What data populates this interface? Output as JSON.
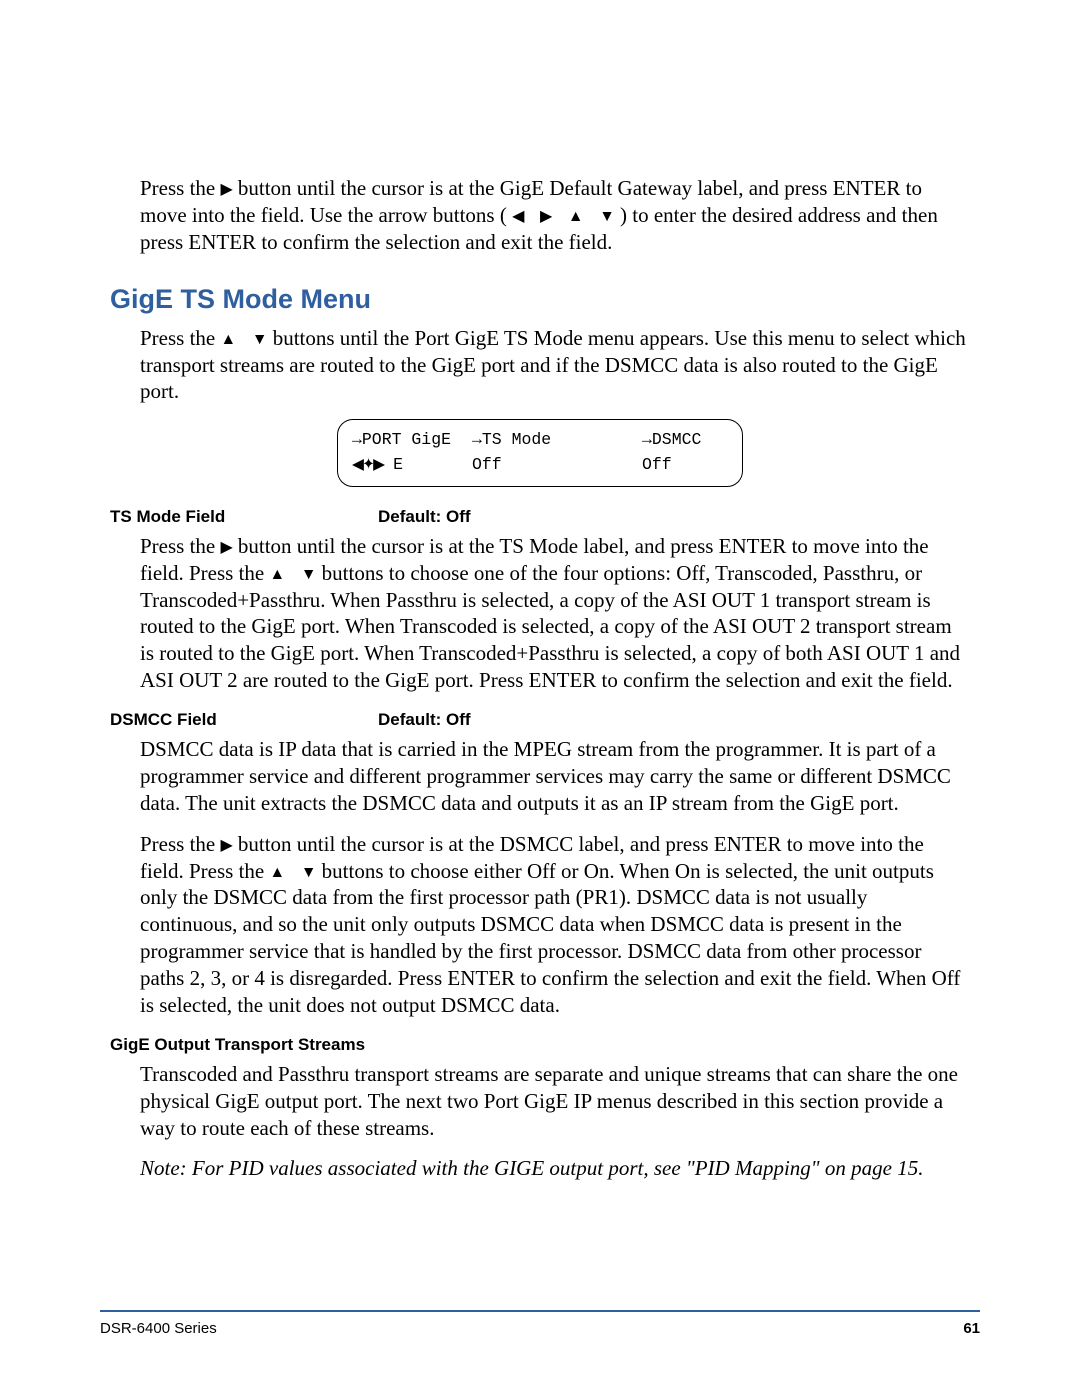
{
  "intro": {
    "p1a": "Press the ",
    "p1b": " button until the cursor is at the GigE Default Gateway label, and press ENTER to move into the field. Use the arrow buttons (",
    "p1c": ") to enter the desired address and then press ENTER to confirm the selection and exit the field."
  },
  "section": {
    "title": "GigE TS Mode Menu",
    "p1a": "Press the ",
    "p1b": " buttons until the Port GigE TS Mode menu appears. Use this menu to select which transport streams are routed to the GigE port and if the DSMCC data is also routed to the GigE port."
  },
  "lcd": {
    "r1c1": "→PORT GigE",
    "r1c2": "→TS Mode",
    "r1c3": "→DSMCC",
    "r2c1_suffix": " E",
    "r2c2": "Off",
    "r2c3": "Off"
  },
  "tsmode": {
    "label": "TS Mode Field",
    "default": "Default: Off",
    "p1a": "Press the ",
    "p1b": " button until the cursor is at the TS Mode label, and press ENTER to move into the field. Press the ",
    "p1c": " buttons to choose one of the four options: Off, Transcoded, Passthru, or Transcoded+Passthru. When Passthru is selected, a copy of the ASI OUT 1 transport stream is routed to the GigE port. When Transcoded is selected, a copy of the ASI OUT 2 transport stream is routed to the GigE port. When Transcoded+Passthru is selected, a copy of both ASI OUT 1 and ASI OUT 2 are routed to the GigE port. Press ENTER to confirm the selection and exit the field."
  },
  "dsmcc": {
    "label": "DSMCC Field",
    "default": "Default: Off",
    "p1": "DSMCC data is IP data that is carried in the MPEG stream from the programmer. It is part of a programmer service and different programmer services may carry the same or different DSMCC data. The unit extracts the DSMCC data and outputs it as an IP stream from the GigE port.",
    "p2a": "Press the ",
    "p2b": " button until the cursor is at the DSMCC label, and press ENTER to move into the field. Press the ",
    "p2c": " buttons to choose either Off or On. When On is selected, the unit outputs only the DSMCC data from the first processor path (PR1). DSMCC data is not usually continuous, and so the unit only outputs DSMCC data when DSMCC data is present in the programmer service that is handled by the first processor. DSMCC data from other processor paths 2, 3, or 4 is disregarded. Press ENTER to confirm the selection and exit the field. When Off is selected, the unit does not output DSMCC data."
  },
  "gige_out": {
    "label": "GigE Output Transport Streams",
    "p1": "Transcoded and Passthru transport streams are separate and unique streams that can share the one physical GigE output port. The next two Port GigE IP menus described in this section provide a way to route each of these streams.",
    "note": "Note:  For PID values associated with the GIGE output port, see \"PID Mapping\" on page 15."
  },
  "footer": {
    "series": "DSR-6400 Series",
    "page": "61"
  }
}
